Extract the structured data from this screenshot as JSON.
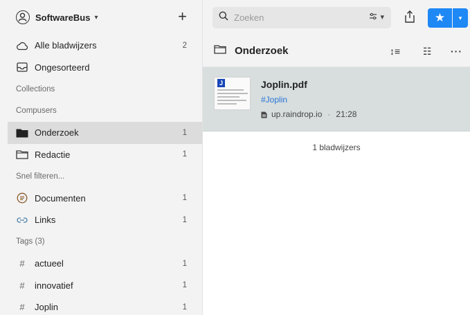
{
  "sidebar": {
    "account_name": "SoftwareBus",
    "account_caret": "▾",
    "add_label": "+",
    "all_bookmarks": {
      "label": "Alle bladwijzers",
      "count": "2"
    },
    "unsorted": {
      "label": "Ongesorteerd"
    },
    "section_collections": "Collections",
    "section_group": "Compusers",
    "collections": [
      {
        "label": "Onderzoek",
        "count": "1",
        "active": true
      },
      {
        "label": "Redactie",
        "count": "1",
        "active": false
      }
    ],
    "section_filters": "Snel filteren...",
    "filters": [
      {
        "label": "Documenten",
        "count": "1",
        "icon": "document-icon"
      },
      {
        "label": "Links",
        "count": "1",
        "icon": "link-icon"
      }
    ],
    "section_tags": "Tags (3)",
    "tags": [
      {
        "hash": "#",
        "label": "actueel",
        "count": "1"
      },
      {
        "hash": "#",
        "label": "innovatief",
        "count": "1"
      },
      {
        "hash": "#",
        "label": "Joplin",
        "count": "1"
      }
    ]
  },
  "toolbar": {
    "search_placeholder": "Zoeken",
    "filter_caret": "▾",
    "star_caret": "▾",
    "accent_color": "#1e88f5"
  },
  "header": {
    "folder_title": "Onderzoek",
    "sort_icon_text": "↕≡",
    "view_icon_text": "☷",
    "more_icon_text": "···"
  },
  "bookmarks": [
    {
      "title": "Joplin.pdf",
      "tag": "#Joplin",
      "domain": "up.raindrop.io",
      "separator": "·",
      "time": "21:28",
      "thumb_letter": "J"
    }
  ],
  "count_text": "1 bladwijzers"
}
